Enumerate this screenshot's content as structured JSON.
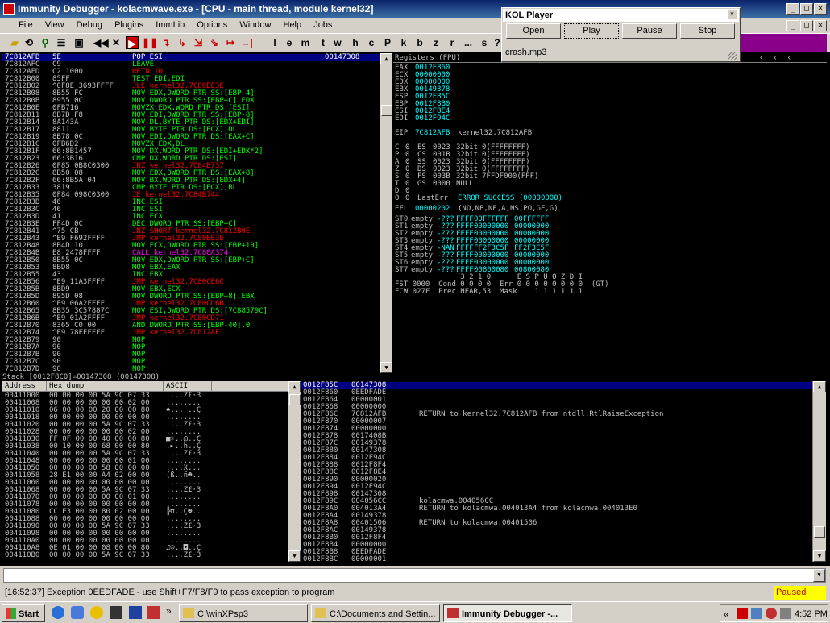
{
  "window": {
    "title": "Immunity Debugger - kolacmwave.exe - [CPU - main thread, module kernel32]"
  },
  "menu": [
    "File",
    "View",
    "Debug",
    "Plugins",
    "ImmLib",
    "Options",
    "Window",
    "Help",
    "Jobs"
  ],
  "toolbar": {
    "letters": [
      "l",
      "e",
      "m",
      "t",
      "w",
      "h",
      "c",
      "P",
      "k",
      "b",
      "z",
      "r",
      "...",
      "s",
      "?"
    ]
  },
  "disasm": {
    "rows": [
      [
        "7C812AFB",
        "5E",
        "POP ESI",
        "00147308"
      ],
      [
        "7C812AFC",
        "C9",
        "LEAVE",
        ""
      ],
      [
        "7C812AFD",
        "C2 1000",
        "RETN 10",
        ""
      ],
      [
        "7C812B00",
        "85FF",
        "TEST EDI,EDI",
        ""
      ],
      [
        "7C812B02",
        "^0F8E 3693FFFF",
        "JLE kernel32.7C80BE3E",
        ""
      ],
      [
        "7C812B08",
        "8B55 FC",
        "MOV EDX,DWORD PTR SS:[EBP-4]",
        ""
      ],
      [
        "7C812B0B",
        "8955 0C",
        "MOV DWORD PTR SS:[EBP+C],EDX",
        ""
      ],
      [
        "7C812B0E",
        "0FB716",
        "MOVZX EDX,WORD PTR DS:[ESI]",
        ""
      ],
      [
        "7C812B11",
        "8B7D F8",
        "MOV EDI,DWORD PTR SS:[EBP-8]",
        ""
      ],
      [
        "7C812B14",
        "8A143A",
        "MOV DL,BYTE PTR DS:[EDX+EDI]",
        ""
      ],
      [
        "7C812B17",
        "8811",
        "MOV BYTE PTR DS:[ECX],DL",
        ""
      ],
      [
        "7C812B19",
        "8B78 0C",
        "MOV EDI,DWORD PTR DS:[EAX+C]",
        ""
      ],
      [
        "7C812B1C",
        "0FB6D2",
        "MOVZX EDX,DL",
        ""
      ],
      [
        "7C812B1F",
        "66:8B1457",
        "MOV DX,WORD PTR DS:[EDI+EDX*2]",
        ""
      ],
      [
        "7C812B23",
        "66:3B16",
        "CMP DX,WORD PTR DS:[ESI]",
        ""
      ],
      [
        "7C812B26",
        "0F85 0B8C0300",
        "JNZ kernel32.7C84B737",
        ""
      ],
      [
        "7C812B2C",
        "8B50 08",
        "MOV EDX,DWORD PTR DS:[EAX+8]",
        ""
      ],
      [
        "7C812B2F",
        "66:8B5A 04",
        "MOV BX,WORD PTR DS:[EDX+4]",
        ""
      ],
      [
        "7C812B33",
        "3819",
        "CMP BYTE PTR DS:[ECX],BL",
        ""
      ],
      [
        "7C812B35",
        "0F84 098C0300",
        "JE kernel32.7C84B744",
        ""
      ],
      [
        "7C812B3B",
        "46",
        "INC ESI",
        ""
      ],
      [
        "7C812B3C",
        "46",
        "INC ESI",
        ""
      ],
      [
        "7C812B3D",
        "41",
        "INC ECX",
        ""
      ],
      [
        "7C812B3E",
        "FF4D 0C",
        "DEC DWORD PTR SS:[EBP+C]",
        ""
      ],
      [
        "7C812B41",
        "^75 CB",
        "JNZ SHORT kernel32.7C812B0E",
        ""
      ],
      [
        "7C812B43",
        "^E9 F692FFFF",
        "JMP kernel32.7C80BE3E",
        ""
      ],
      [
        "7C812B48",
        "8B4D 10",
        "MOV ECX,DWORD PTR SS:[EBP+10]",
        ""
      ],
      [
        "7C812B4B",
        "E8 2478FFFF",
        "CALL kernel32.7C80A374",
        ""
      ],
      [
        "7C812B50",
        "8B55 0C",
        "MOV EDX,DWORD PTR SS:[EBP+C]",
        ""
      ],
      [
        "7C812B53",
        "8BD8",
        "MOV EBX,EAX",
        ""
      ],
      [
        "7C812B55",
        "43",
        "INC EBX",
        ""
      ],
      [
        "7C812B56",
        "^E9 11A3FFFF",
        "JMP kernel32.7C80CE6C",
        ""
      ],
      [
        "7C812B5B",
        "8BD9",
        "MOV EBX,ECX",
        ""
      ],
      [
        "7C812B5D",
        "895D 08",
        "MOV DWORD PTR SS:[EBP+8],EBX",
        ""
      ],
      [
        "7C812B60",
        "^E9 06A2FFFF",
        "JMP kernel32.7C80CD6B",
        ""
      ],
      [
        "7C812B65",
        "8B35 3C57887C",
        "MOV ESI,DWORD PTR DS:[7C88579C]",
        ""
      ],
      [
        "7C812B6B",
        "^E9 01A2FFFF",
        "JMP kernel32.7C80CD71",
        ""
      ],
      [
        "7C812B70",
        "8365 C0 00",
        "AND DWORD PTR SS:[EBP-40],0",
        ""
      ],
      [
        "7C812B74",
        "^E9 78FFFFFF",
        "JMP kernel32.7C812AF1",
        ""
      ],
      [
        "7C812B79",
        "90",
        "NOP",
        ""
      ],
      [
        "7C812B7A",
        "90",
        "NOP",
        ""
      ],
      [
        "7C812B7B",
        "90",
        "NOP",
        ""
      ],
      [
        "7C812B7C",
        "90",
        "NOP",
        ""
      ],
      [
        "7C812B7D",
        "90",
        "NOP",
        ""
      ]
    ],
    "info": "Stack [0012F8C0]=00147308 (00147308)"
  },
  "registers": {
    "title": "Registers (FPU)",
    "gp": [
      [
        "EAX",
        "0012F860"
      ],
      [
        "ECX",
        "00000000"
      ],
      [
        "EDX",
        "00000000"
      ],
      [
        "EBX",
        "00149378"
      ],
      [
        "ESP",
        "0012F85C"
      ],
      [
        "EBP",
        "0012F8B0"
      ],
      [
        "ESI",
        "0012F8E4"
      ],
      [
        "EDI",
        "0012F94C"
      ]
    ],
    "eip": [
      "EIP",
      "7C812AFB",
      "kernel32.7C812AFB"
    ],
    "flags": [
      [
        "C",
        "0",
        "ES",
        "0023",
        "32bit",
        "0(FFFFFFFF)"
      ],
      [
        "P",
        "0",
        "CS",
        "001B",
        "32bit",
        "0(FFFFFFFF)"
      ],
      [
        "A",
        "0",
        "SS",
        "0023",
        "32bit",
        "0(FFFFFFFF)"
      ],
      [
        "Z",
        "0",
        "DS",
        "0023",
        "32bit",
        "0(FFFFFFFF)"
      ],
      [
        "S",
        "0",
        "FS",
        "003B",
        "32bit",
        "7FFDF000(FFF)"
      ],
      [
        "T",
        "0",
        "GS",
        "0000",
        "NULL",
        ""
      ],
      [
        "D",
        "0",
        "",
        "",
        "",
        ""
      ]
    ],
    "lasterr": [
      "O",
      "0",
      "LastErr",
      "ERROR_SUCCESS (00000000)"
    ],
    "efl": [
      "EFL",
      "00000202",
      "(NO,NB,NE,A,NS,PO,GE,G)"
    ],
    "fpu": [
      [
        "ST0",
        "empty",
        "-???",
        "FFFF",
        "00FFFFFF",
        "00FFFFFF"
      ],
      [
        "ST1",
        "empty",
        "-???",
        "FFFF",
        "00000000",
        "00000000"
      ],
      [
        "ST2",
        "empty",
        "-???",
        "FFFF",
        "00000000",
        "00000000"
      ],
      [
        "ST3",
        "empty",
        "-???",
        "FFFF",
        "00000000",
        "00000000"
      ],
      [
        "ST4",
        "empty",
        "-NAN",
        "FFFF",
        "FF2F3C5F",
        "FF2F3C5F"
      ],
      [
        "ST5",
        "empty",
        "-???",
        "FFFF",
        "00000000",
        "00000000"
      ],
      [
        "ST6",
        "empty",
        "-???",
        "FFFF",
        "00000000",
        "00000000"
      ],
      [
        "ST7",
        "empty",
        "-???",
        "FFFF",
        "00800080",
        "00800080"
      ]
    ],
    "fpuhdr": "               3 2 1 0      E S P U O Z D I",
    "fst": "FST 0000  Cond 0 0 0 0  Err 0 0 0 0 0 0 0 0  (GT)",
    "fcw": "FCW 027F  Prec NEAR,53  Mask    1 1 1 1 1 1"
  },
  "dump": {
    "headers": [
      "Address",
      "Hex dump",
      "ASCII"
    ],
    "rows": [
      [
        "00411000",
        "00 00 00 00 5A 9C 07 33",
        "....Z£·3"
      ],
      [
        "00411008",
        "00 00 00 00 00 00 02 00",
        "........"
      ],
      [
        "00411010",
        "06 00 00 00 20 00 00 80",
        "♠... ..Ç"
      ],
      [
        "00411018",
        "00 00 00 00 00 00 00 00",
        "........"
      ],
      [
        "00411020",
        "00 00 00 00 5A 9C 07 33",
        "....Z£·3"
      ],
      [
        "00411028",
        "00 00 00 00 00 00 02 00",
        "........"
      ],
      [
        "00411030",
        "FF 0F 00 00 40 00 00 80",
        "■☼..@..Ç"
      ],
      [
        "00411038",
        "00 10 00 00 68 00 00 80",
        ".►..h..Ç"
      ],
      [
        "00411040",
        "00 00 00 00 5A 9C 07 33",
        "....Z£·3"
      ],
      [
        "00411048",
        "00 00 00 00 00 00 01 00",
        "........"
      ],
      [
        "00411050",
        "00 00 00 00 58 00 00 00",
        "....X..."
      ],
      [
        "00411058",
        "28 E1 00 00 A4 02 00 00",
        "(ß..ñ☻.."
      ],
      [
        "00411060",
        "00 00 00 00 00 00 00 00",
        "........"
      ],
      [
        "00411068",
        "00 00 00 00 5A 9C 07 33",
        "....Z£·3"
      ],
      [
        "00411070",
        "00 00 00 00 00 00 01 00",
        "........"
      ],
      [
        "00411078",
        "00 00 00 00 00 00 00 00",
        "........"
      ],
      [
        "00411080",
        "CC E3 00 00 80 02 00 00",
        "╠π..Ç☻.."
      ],
      [
        "00411088",
        "00 00 00 00 00 00 00 00",
        "........"
      ],
      [
        "00411090",
        "00 00 00 00 5A 9C 07 33",
        "....Z£·3"
      ],
      [
        "00411098",
        "00 00 00 00 00 00 00 00",
        "........"
      ],
      [
        "004110A0",
        "00 00 00 00 00 00 00 00",
        "........"
      ],
      [
        "004110A8",
        "0E 01 00 00 08 00 00 80",
        "♫☺..◘..Ç"
      ],
      [
        "004110B0",
        "00 00 00 00 5A 9C 07 33",
        "....Z£·3"
      ]
    ]
  },
  "stack": {
    "rows": [
      [
        "0012F85C",
        "00147308",
        "",
        "",
        true
      ],
      [
        "0012F860",
        "0EEDFADE",
        "",
        "",
        false
      ],
      [
        "0012F864",
        "00000001",
        "",
        "",
        false
      ],
      [
        "0012F868",
        "00000000",
        "",
        "",
        false
      ],
      [
        "0012F86C",
        "7C812AFB",
        "",
        "RETURN to kernel32.7C812AFB from ntdll.RtlRaiseException",
        false
      ],
      [
        "0012F870",
        "00000007",
        "",
        "",
        false
      ],
      [
        "0012F874",
        "00000000",
        "",
        "",
        false
      ],
      [
        "0012F878",
        "0017408B",
        "",
        "",
        false
      ],
      [
        "0012F87C",
        "00149378",
        "",
        "",
        false
      ],
      [
        "0012F880",
        "00147308",
        "",
        "",
        false
      ],
      [
        "0012F884",
        "0012F94C",
        "",
        "",
        false
      ],
      [
        "0012F888",
        "0012F8F4",
        "",
        "",
        false
      ],
      [
        "0012F88C",
        "0012F8E4",
        "",
        "",
        false
      ],
      [
        "0012F890",
        "00000020",
        "",
        "",
        false
      ],
      [
        "0012F894",
        "0012F94C",
        "",
        "",
        false
      ],
      [
        "0012F898",
        "00147308",
        "",
        "",
        false
      ],
      [
        "0012F89C",
        "004056CC",
        "",
        "kolacmwa.004056CC",
        false
      ],
      [
        "0012F8A0",
        "004013A4",
        "",
        "RETURN to kolacmwa.004013A4 from kolacmwa.004013E0",
        false
      ],
      [
        "0012F8A4",
        "00149378",
        "",
        "",
        false
      ],
      [
        "0012F8A8",
        "00401506",
        "",
        "RETURN to kolacmwa.00401506",
        false
      ],
      [
        "0012F8AC",
        "00149378",
        "",
        "",
        false
      ],
      [
        "0012F8B0",
        "0012F8F4",
        "",
        "",
        false
      ],
      [
        "0012F8B4",
        "00000000",
        "",
        "",
        false
      ],
      [
        "0012F8B8",
        "0EEDFADE",
        "",
        "",
        false
      ],
      [
        "0012F8BC",
        "00000001",
        "",
        "",
        false
      ]
    ]
  },
  "status": {
    "text": "[16:52:37] Exception 0EEDFADE - use Shift+F7/F8/F9 to pass exception to program",
    "state": "Paused"
  },
  "kol": {
    "title": "KOL Player",
    "buttons": [
      "Open",
      "Play",
      "Pause",
      "Stop"
    ],
    "file": "crash.mp3"
  },
  "taskbar": {
    "start": "Start",
    "tasks": [
      "C:\\winXPsp3",
      "C:\\Documents and Settin...",
      "Immunity Debugger -..."
    ],
    "clock": "4:52 PM"
  },
  "colors": {
    "cmd": "#00ff00",
    "jmp": "#ff0000",
    "call": "#ff00ff",
    "addr": "#00ffff",
    "stackaddr": "#ffff00",
    "text": "#c0c0c0",
    "white": "#ffffff",
    "sel": "#000080"
  }
}
